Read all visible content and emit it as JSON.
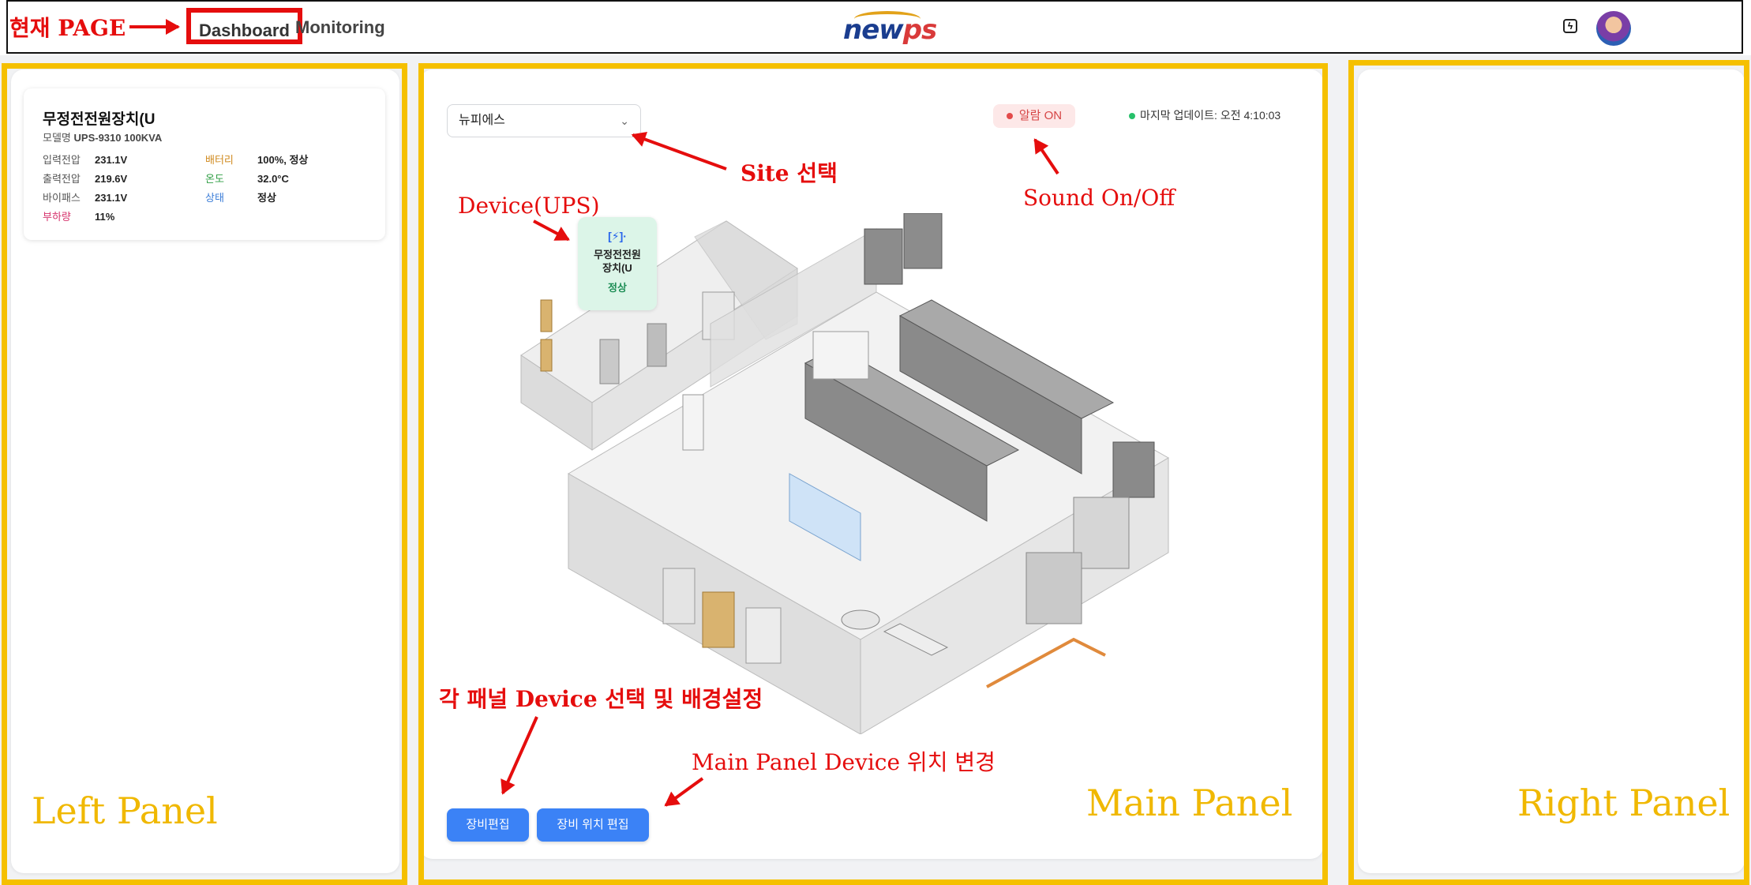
{
  "nav": {
    "links": [
      "Dashboard",
      "Monitoring"
    ],
    "active": "Dashboard",
    "logo_text_new": "new",
    "logo_text_ps": "ps"
  },
  "colors": {
    "accent_blue": "#3b82f6",
    "annotation_red": "#e50d0d",
    "region_yellow": "#f5c000",
    "status_green": "#27c06a",
    "alarm_red": "#e34b4b"
  },
  "annotations": {
    "current_page": "현재 PAGE",
    "site_select": "Site 선택",
    "device_ups": "Device(UPS)",
    "sound_toggle": "Sound On/Off",
    "panel_device_setting": "각 패널 Device 선택 및 배경설정",
    "main_panel_position": "Main Panel Device 위치 변경",
    "left_panel": "Left Panel",
    "main_panel": "Main Panel",
    "right_panel": "Right Panel"
  },
  "left_panel": {
    "card": {
      "title": "무정전전원장치(U",
      "model_label": "모델명",
      "model_value": "UPS-9310 100KVA",
      "rows": [
        {
          "k": "입력전압",
          "v": "231.1V",
          "color": "#555555"
        },
        {
          "k": "출력전압",
          "v": "219.6V",
          "color": "#555555"
        },
        {
          "k": "바이패스",
          "v": "231.1V",
          "color": "#555555"
        },
        {
          "k": "부하량",
          "v": "11%",
          "color": "#d6336c"
        },
        {
          "k": "배터리",
          "v": "100%, 정상",
          "color": "#d08a1e"
        },
        {
          "k": "온도",
          "v": "32.0°C",
          "color": "#2f9e44"
        },
        {
          "k": "상태",
          "v": "정상",
          "color": "#3b7dd8"
        }
      ]
    }
  },
  "main_panel": {
    "site_select_value": "뉴피에스",
    "alarm_label": "알람 ON",
    "last_update": "마지막 업데이트: 오전 4:10:03",
    "device_tag": {
      "icon": "[⚡]·",
      "name_line1": "무정전전원",
      "name_line2": "장치(U",
      "status": "정상"
    },
    "buttons": {
      "edit_devices": "장비편집",
      "edit_positions": "장비 위치 편집"
    }
  }
}
